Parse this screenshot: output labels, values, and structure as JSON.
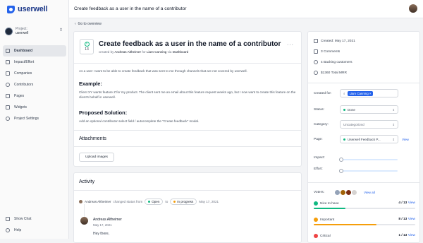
{
  "app": {
    "logo_text": "userwell"
  },
  "project": {
    "label": "Project:",
    "name": "userwell"
  },
  "sidebar": {
    "items": [
      {
        "label": "Dashboard",
        "active": true
      },
      {
        "label": "Impact/Effort"
      },
      {
        "label": "Companies"
      },
      {
        "label": "Contributors"
      },
      {
        "label": "Pages"
      },
      {
        "label": "Widgets"
      },
      {
        "label": "Project Settings"
      }
    ],
    "bottom": [
      {
        "label": "Show Chat"
      },
      {
        "label": "Help"
      }
    ]
  },
  "topbar": {
    "title": "Create feedback as a user in the name of a contributor"
  },
  "back_link": "Go to overview",
  "post": {
    "vote_count": "13",
    "title": "Create feedback as a user in the name of a contributor",
    "meta_prefix": "created by",
    "author": "Andreas Altheimer",
    "meta_for": "for",
    "contributor": "Liam Canning",
    "meta_via": "via",
    "source": "Dashboard",
    "more": "···",
    "intro": "As a user I want to be able to create feedback that was sent to me through channels that are not covered by userwell.",
    "example_heading": "Example:",
    "example_text": "Client XY wants feature Z for my product. The client sent me an email about this feature request weeks ago, but I now want to create this feature on the client's behalf in userwell.",
    "solution_heading": "Proposed Solution:",
    "solution_text": "Add an optional contributor select field / autocomplete the \"Create feedback\" modal.",
    "attachments_heading": "Attachments",
    "upload_label": "Upload images"
  },
  "activity": {
    "title": "Activity",
    "event": {
      "actor": "Andreas Altheimer",
      "action": "changed status from",
      "from": "Open",
      "to_word": "to",
      "to": "In progress",
      "date": "May 17, 2021"
    },
    "comment": {
      "author": "Andreas Altheimer",
      "date": "May 17, 2021",
      "text": "Hey there,"
    }
  },
  "sidebar_right": {
    "stats": [
      {
        "icon": "calendar-icon",
        "text": "Created: May 17, 2021"
      },
      {
        "icon": "comment-icon",
        "text": "3 Comments"
      },
      {
        "icon": "users-icon",
        "text": "4 Backing customers"
      },
      {
        "icon": "money-icon",
        "text": "$1360 Total MRR"
      }
    ],
    "created_for_label": "Created for:",
    "created_for_value": "Liam Canning",
    "status_label": "Status:",
    "status_value": "Done",
    "category_label": "Category:",
    "category_value": "Uncategorized",
    "page_label": "Page:",
    "page_value": "Userwell Feedback P...",
    "page_view": "View",
    "impact_label": "Impact:",
    "impact_level": 0,
    "effort_label": "Effort:",
    "effort_level": 0,
    "voters_label": "Voters:",
    "voters_view_all": "View all",
    "priorities": [
      {
        "label": "Nice to have",
        "value": "4 / 13",
        "view": "View",
        "color": "#10b981",
        "fraction": 0.31
      },
      {
        "label": "Important",
        "value": "8 / 13",
        "view": "View",
        "color": "#f59e0b",
        "fraction": 0.62
      },
      {
        "label": "Critical",
        "value": "1 / 13",
        "view": "View",
        "color": "#ef4444",
        "fraction": 0.08
      }
    ]
  },
  "colors": {
    "accent": "#2563eb",
    "done": "#10b981",
    "open": "#10b981",
    "in_progress": "#f59e0b"
  }
}
